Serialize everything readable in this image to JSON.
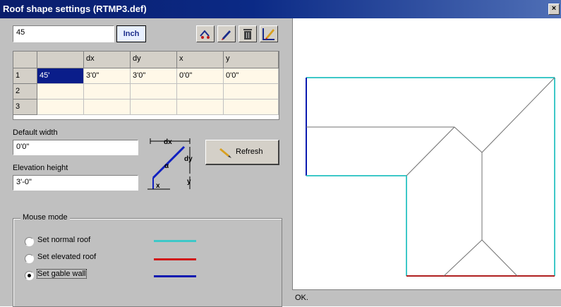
{
  "window": {
    "title": "Roof shape settings (RTMP3.def)",
    "close_label": "×"
  },
  "angle_input": {
    "value": "45"
  },
  "unit_button": {
    "label": "Inch"
  },
  "toolbar": {
    "icons": [
      "roof-pick-icon",
      "pen-icon",
      "trash-icon",
      "ruler-pencil-icon"
    ]
  },
  "table": {
    "headers": [
      "",
      "",
      "dx",
      "dy",
      "x",
      "y"
    ],
    "rows": [
      {
        "num": "1",
        "angle": "45'",
        "dx": "3'0\"",
        "dy": "3'0\"",
        "x": "0'0\"",
        "y": "0'0\""
      },
      {
        "num": "2",
        "angle": "",
        "dx": "",
        "dy": "",
        "x": "",
        "y": ""
      },
      {
        "num": "3",
        "angle": "",
        "dx": "",
        "dy": "",
        "x": "",
        "y": ""
      }
    ]
  },
  "default_width": {
    "label": "Default width",
    "value": "0'0\""
  },
  "elevation_height": {
    "label": "Elevation height",
    "value": "3'-0\""
  },
  "diagram": {
    "dx": "dx",
    "dy": "dy",
    "alpha": "α",
    "x": "x",
    "y": "y"
  },
  "refresh_button": {
    "label": "Refresh"
  },
  "mouse_mode": {
    "title": "Mouse mode",
    "options": [
      {
        "label": "Set normal roof",
        "color": "#3ec8c8",
        "selected": false
      },
      {
        "label": "Set elevated roof",
        "color": "#d01818",
        "selected": false
      },
      {
        "label": "Set gable wall",
        "color": "#0c1ab0",
        "selected": true
      }
    ]
  },
  "status": {
    "text": "OK."
  }
}
